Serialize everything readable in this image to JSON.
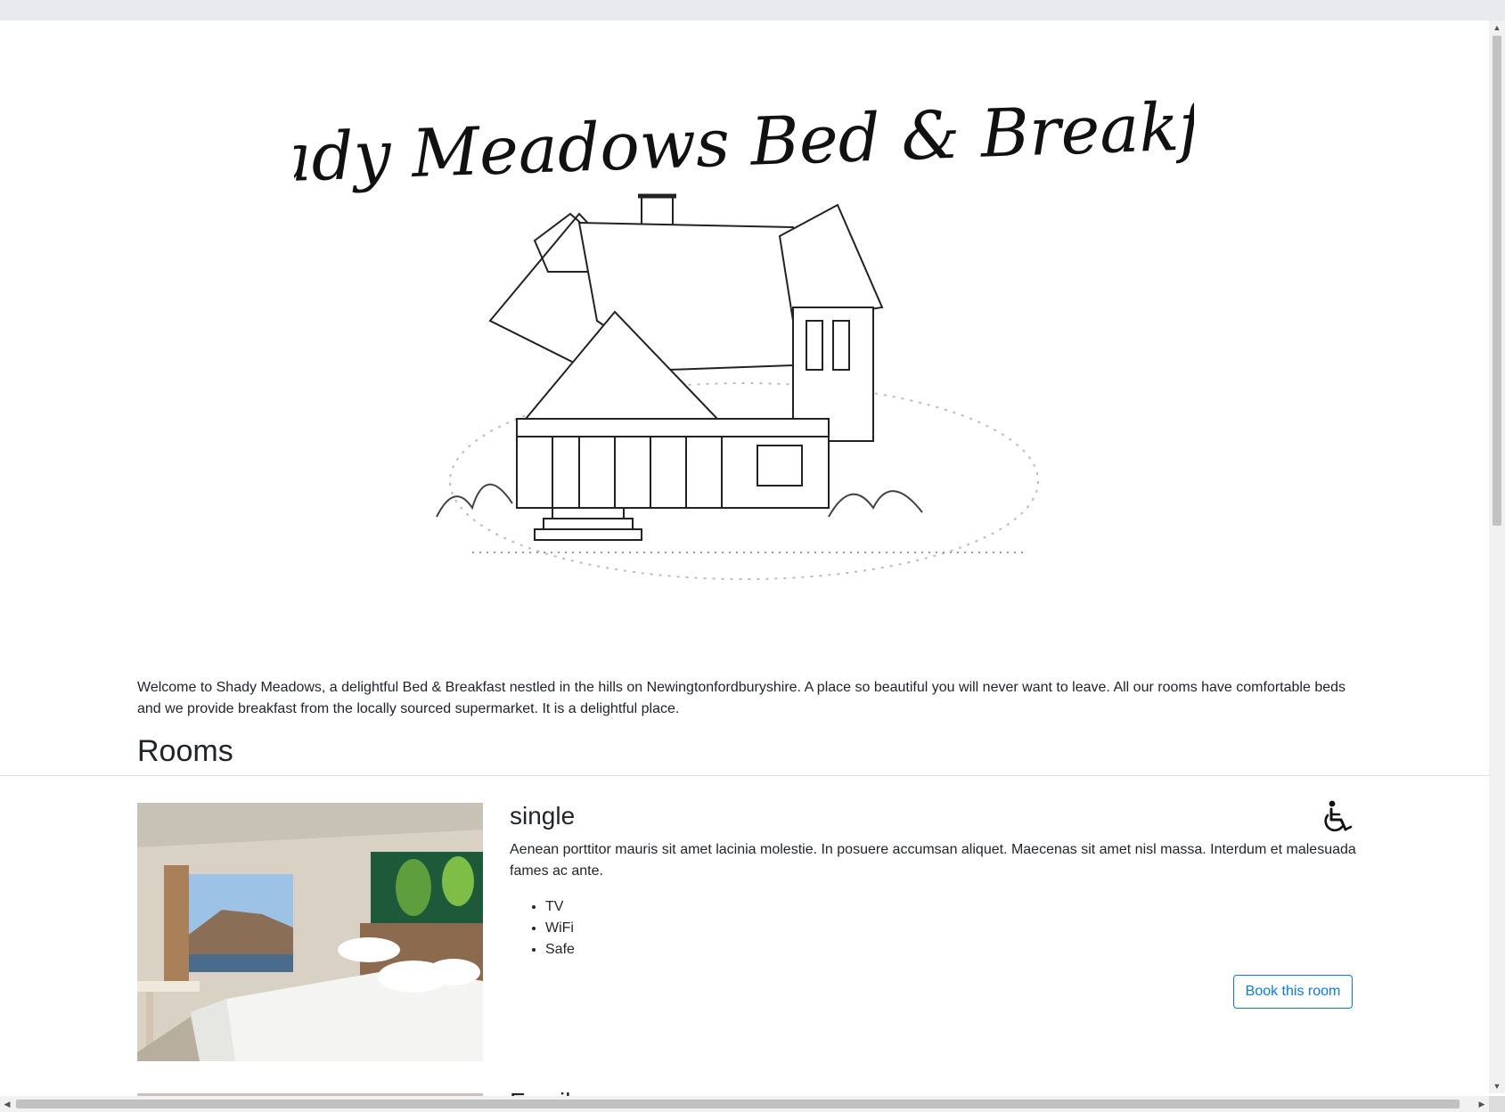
{
  "site": {
    "logo_text": "Shady Meadows Bed & Breakfast",
    "welcome_text": "Welcome to Shady Meadows, a delightful Bed & Breakfast nestled in the hills on Newingtonfordburyshire. A place so beautiful you will never want to leave. All our rooms have comfortable beds and we provide breakfast from the locally sourced supermarket. It is a delightful place."
  },
  "rooms_section": {
    "heading": "Rooms",
    "rooms": [
      {
        "type": "single",
        "accessible_icon": "wheelchair-icon",
        "description": "Aenean porttitor mauris sit amet lacinia molestie. In posuere accumsan aliquet. Maecenas sit amet nisl massa. Interdum et malesuada fames ac ante.",
        "features": [
          "TV",
          "WiFi",
          "Safe"
        ],
        "book_label": "Book this room"
      },
      {
        "type": "Family"
      }
    ]
  },
  "colors": {
    "primary": "#007bff",
    "text": "#212529",
    "divider": "#dee2e6"
  }
}
